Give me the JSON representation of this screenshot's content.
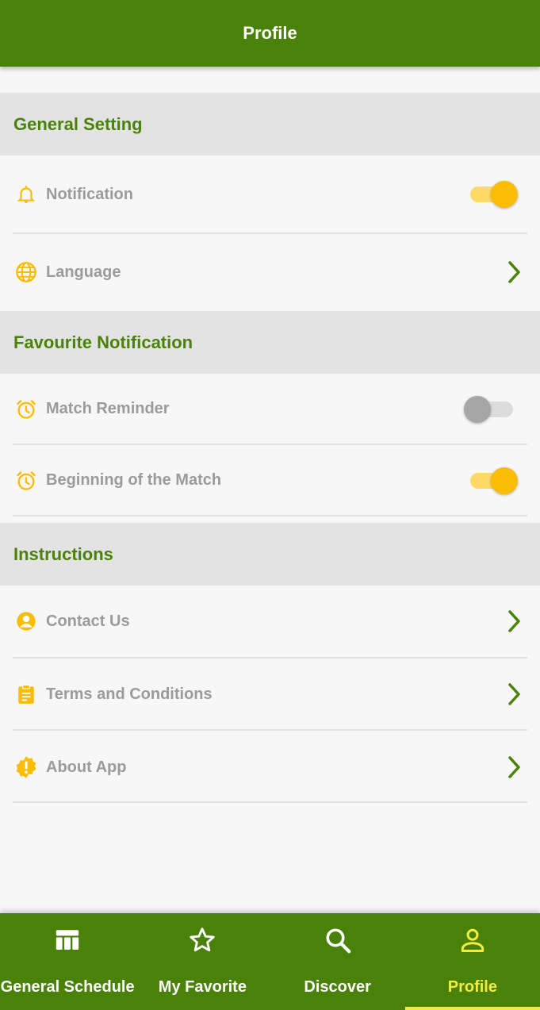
{
  "appbar": {
    "title": "Profile"
  },
  "sections": {
    "general": "General Setting",
    "favourite": "Favourite Notification",
    "instructions": "Instructions"
  },
  "rows": {
    "notification": {
      "label": "Notification",
      "icon": "bell-icon",
      "toggle": true
    },
    "language": {
      "label": "Language",
      "icon": "globe-icon"
    },
    "match_reminder": {
      "label": "Match Reminder",
      "icon": "alarm-clock-icon",
      "toggle": false
    },
    "beginning": {
      "label": "Beginning of the Match",
      "icon": "alarm-clock-icon",
      "toggle": true
    },
    "contact": {
      "label": "Contact Us",
      "icon": "account-circle-icon"
    },
    "terms": {
      "label": "Terms and Conditions",
      "icon": "clipboard-icon"
    },
    "about": {
      "label": "About App",
      "icon": "alert-badge-icon"
    }
  },
  "nav": {
    "schedule": "General Schedule",
    "favorite": "My Favorite",
    "discover": "Discover",
    "profile": "Profile",
    "active": "profile"
  },
  "colors": {
    "primary": "#4a8209",
    "accent": "#fbbc05",
    "nav_active": "#f3ec3f",
    "label_grey": "#9b9b9b"
  }
}
